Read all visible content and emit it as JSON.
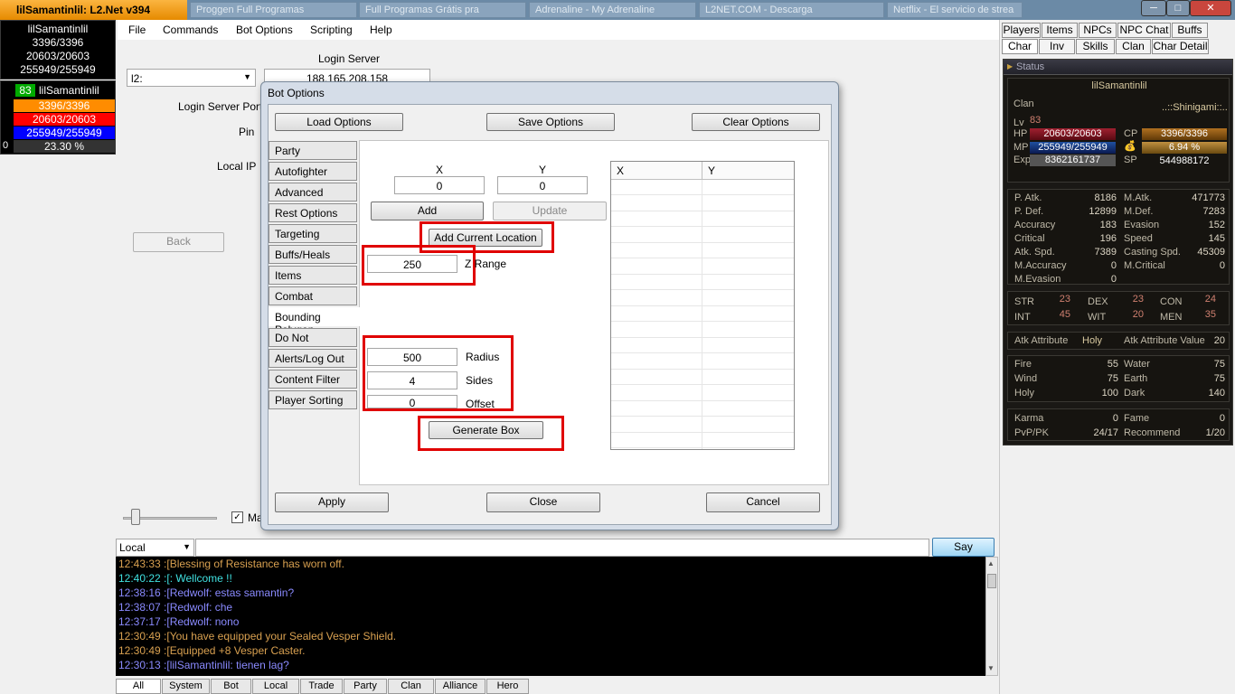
{
  "titlebar": {
    "app_title": "lilSamantinlil: L2.Net v394",
    "ghost_tabs": [
      "Proggen Full Programas",
      "Full Programas Grátis pra",
      "Adrenaline - My Adrenaline",
      "L2NET.COM - Descarga",
      "Netflix - El servicio de strea"
    ],
    "minimize": "─",
    "maximize": "□",
    "close": "✕"
  },
  "left_panel": {
    "name": "lilSamantinlil",
    "cp": "3396/3396",
    "hp": "20603/20603",
    "mp": "255949/255949",
    "target_level": "83",
    "target_name": "lilSamantinlil",
    "target_cp": "3396/3396",
    "target_hp": "20603/20603",
    "target_mp": "255949/255949",
    "target_exp": "23.30 %",
    "counter": "0",
    "colors": {
      "cp": "#ff8c00",
      "hp": "#ff0000",
      "mp": "#0000ff",
      "level": "#00aa00"
    }
  },
  "menubar": {
    "items": [
      "File",
      "Commands",
      "Bot Options",
      "Scripting",
      "Help"
    ]
  },
  "login": {
    "server_select": "l2:",
    "server_label": "Login Server",
    "server_value": "188.165.208.158",
    "port_label": "Login Server Port",
    "pin_label": "Pin",
    "local_ip_label": "Local IP",
    "back_button": "Back",
    "checkbox_label": "Ma",
    "slider_value": 0.05
  },
  "dialog": {
    "title": "Bot Options",
    "load": "Load Options",
    "save": "Save Options",
    "clear": "Clear Options",
    "apply": "Apply",
    "close": "Close",
    "cancel": "Cancel",
    "side_tabs": [
      "Party",
      "Autofighter",
      "Advanced",
      "Rest Options",
      "Targeting",
      "Buffs/Heals",
      "Items",
      "Combat",
      "Bounding Polygon",
      "Do Not",
      "Alerts/Log Out",
      "Content Filter",
      "Player Sorting"
    ],
    "selected_tab": "Bounding Polygon",
    "x_label": "X",
    "y_label": "Y",
    "x_value": "0",
    "y_value": "0",
    "add": "Add",
    "update": "Update",
    "add_current": "Add Current Location",
    "z_value": "250",
    "z_label": "Z Range",
    "radius_value": "500",
    "radius_label": "Radius",
    "sides_value": "4",
    "sides_label": "Sides",
    "offset_value": "0",
    "offset_label": "Offset",
    "generate": "Generate Box",
    "grid_headers": [
      "X",
      "Y"
    ]
  },
  "chat": {
    "channel": "Local",
    "say": "Say",
    "lines": [
      {
        "text": "12:43:33 :[Blessing of Resistance has worn off.",
        "color": "#d8a050"
      },
      {
        "text": "12:40:22 :[: Wellcome !!",
        "color": "#40e0e0"
      },
      {
        "text": "12:38:16 :[Redwolf: estas samantin?",
        "color": "#8a8aff"
      },
      {
        "text": "12:38:07 :[Redwolf: che",
        "color": "#8a8aff"
      },
      {
        "text": "12:37:17 :[Redwolf: nono",
        "color": "#8a8aff"
      },
      {
        "text": "12:30:49 :[You have equipped your Sealed Vesper Shield.",
        "color": "#d8a050"
      },
      {
        "text": "12:30:49 :[Equipped +8 Vesper Caster.",
        "color": "#d8a050"
      },
      {
        "text": "12:30:13 :[lilSamantinlil: tienen lag?",
        "color": "#8a8aff"
      }
    ],
    "tabs": [
      "All",
      "System",
      "Bot",
      "Local",
      "Trade",
      "Party",
      "Clan",
      "Alliance",
      "Hero"
    ]
  },
  "right_tabs": {
    "row1": [
      "Players",
      "Items",
      "NPCs",
      "NPC Chat",
      "Buffs"
    ],
    "row2": [
      "Char",
      "Inv",
      "Skills",
      "Clan",
      "Char Detail"
    ]
  },
  "status": {
    "header": "Status",
    "name": "lilSamantinlil",
    "clan_label": "Clan",
    "clan": "..::Shinigami::..",
    "lv_label": "Lv",
    "lv": "83",
    "hp_label": "HP",
    "hp": "20603/20603",
    "mp_label": "MP",
    "mp": "255949/255949",
    "exp_label": "Exp",
    "exp": "8362161737",
    "cp_label": "CP",
    "cp": "3396/3396",
    "exp_pct": "6.94 %",
    "sp_label": "SP",
    "sp": "544988172",
    "stats_left": [
      {
        "k": "P. Atk.",
        "v": "8186"
      },
      {
        "k": "P. Def.",
        "v": "12899"
      },
      {
        "k": "Accuracy",
        "v": "183"
      },
      {
        "k": "Critical",
        "v": "196"
      },
      {
        "k": "Atk. Spd.",
        "v": "7389"
      },
      {
        "k": "M.Accuracy",
        "v": "0"
      },
      {
        "k": "M.Evasion",
        "v": "0"
      }
    ],
    "stats_right": [
      {
        "k": "M.Atk.",
        "v": "471773"
      },
      {
        "k": "M.Def.",
        "v": "7283"
      },
      {
        "k": "Evasion",
        "v": "152"
      },
      {
        "k": "Speed",
        "v": "145"
      },
      {
        "k": "Casting Spd.",
        "v": "45309"
      },
      {
        "k": "M.Critical",
        "v": "0"
      }
    ],
    "attrs": [
      {
        "k": "STR",
        "v": "23"
      },
      {
        "k": "DEX",
        "v": "23"
      },
      {
        "k": "CON",
        "v": "24"
      },
      {
        "k": "INT",
        "v": "45"
      },
      {
        "k": "WIT",
        "v": "20"
      },
      {
        "k": "MEN",
        "v": "35"
      }
    ],
    "atk_attr_label": "Atk Attribute",
    "atk_attr": "Holy",
    "atk_attr_value_label": "Atk Attribute Value",
    "atk_attr_value": "20",
    "elements_left": [
      {
        "k": "Fire",
        "v": "55"
      },
      {
        "k": "Wind",
        "v": "75"
      },
      {
        "k": "Holy",
        "v": "100"
      }
    ],
    "elements_right": [
      {
        "k": "Water",
        "v": "75"
      },
      {
        "k": "Earth",
        "v": "75"
      },
      {
        "k": "Dark",
        "v": "140"
      }
    ],
    "karma_label": "Karma",
    "karma": "0",
    "fame_label": "Fame",
    "fame": "0",
    "pvp_label": "PvP/PK",
    "pvp": "24/17",
    "recommend_label": "Recommend",
    "recommend": "1/20"
  }
}
